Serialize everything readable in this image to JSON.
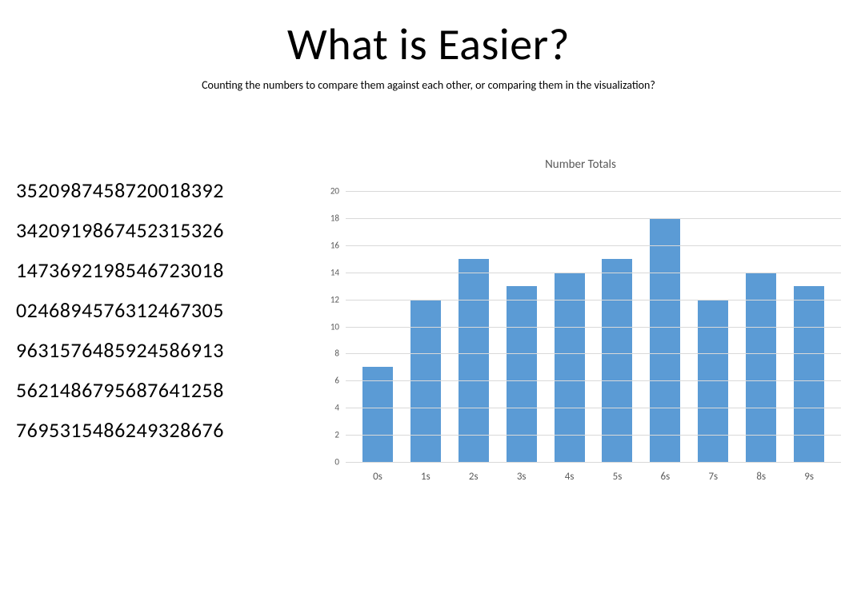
{
  "header": {
    "title": "What is Easier?",
    "subtitle": "Counting the numbers to compare them against each other, or comparing them in the visualization?"
  },
  "numbers": [
    "3520987458720018392",
    "3420919867452315326",
    "1473692198546723018",
    "0246894576312467305",
    "9631576485924586913",
    "5621486795687641258",
    "7695315486249328676"
  ],
  "chart_data": {
    "type": "bar",
    "title": "Number Totals",
    "categories": [
      "0s",
      "1s",
      "2s",
      "3s",
      "4s",
      "5s",
      "6s",
      "7s",
      "8s",
      "9s"
    ],
    "values": [
      7,
      12,
      15,
      13,
      14,
      15,
      18,
      12,
      14,
      13
    ],
    "xlabel": "",
    "ylabel": "",
    "ylim": [
      0,
      20
    ],
    "yticks": [
      0,
      2,
      4,
      6,
      8,
      10,
      12,
      14,
      16,
      18,
      20
    ]
  }
}
